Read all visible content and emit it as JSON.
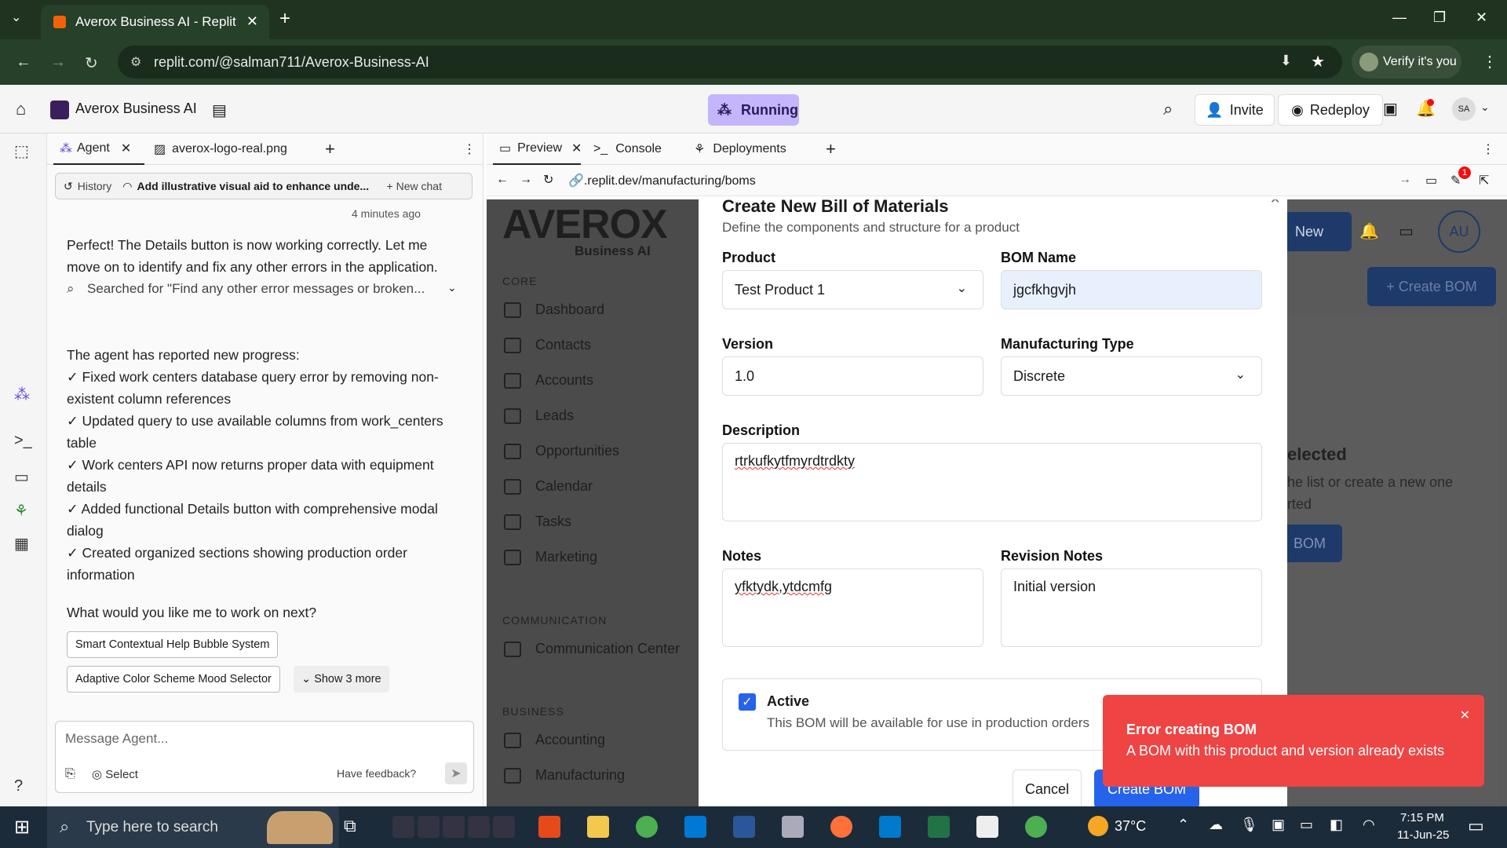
{
  "browser": {
    "tab_title": "Averox Business AI - Replit",
    "url": "replit.com/@salman711/Averox-Business-AI",
    "verify_label": "Verify it's you"
  },
  "replit": {
    "project_name": "Averox Business AI",
    "run_status": "Running",
    "invite_label": "Invite",
    "redeploy_label": "Redeploy",
    "avatar_initials": "SA"
  },
  "agent": {
    "tabs": [
      "Agent",
      "averox-logo-real.png"
    ],
    "history_label": "History",
    "chat_title": "Add illustrative visual aid to enhance unde...",
    "new_chat_label": "New chat",
    "time_ago": "4 minutes ago",
    "message1": "Perfect! The Details button is now working correctly. Let me move on to identify and fix any other errors in the application.",
    "searched": "Searched for \"Find any other error messages or broken...",
    "progress_intro": "The agent has reported new progress:",
    "progress": [
      "✓ Fixed work centers database query error by removing non-existent column references",
      "✓ Updated query to use available columns from work_centers table",
      "✓ Work centers API now returns proper data with equipment details",
      "✓ Added functional Details button with comprehensive modal dialog",
      "✓ Created organized sections showing production order information"
    ],
    "question": "What would you like me to work on next?",
    "suggestions": [
      "Smart Contextual Help Bubble System",
      "Adaptive Color Scheme Mood Selector"
    ],
    "show_more": "Show 3 more",
    "input_placeholder": "Message Agent...",
    "select_label": "Select",
    "feedback_label": "Have feedback?"
  },
  "preview": {
    "tabs": [
      "Preview",
      "Console",
      "Deployments"
    ],
    "url": ".replit.dev/manufacturing/boms",
    "badge_count": "1"
  },
  "app": {
    "logo_text": "AVEROX",
    "logo_sub": "Business AI",
    "sections": {
      "core": "CORE",
      "communication": "COMMUNICATION",
      "business": "BUSINESS"
    },
    "nav": [
      "Dashboard",
      "Contacts",
      "Accounts",
      "Leads",
      "Opportunities",
      "Calendar",
      "Tasks",
      "Marketing"
    ],
    "comm_nav": [
      "Communication Center"
    ],
    "biz_nav": [
      "Accounting",
      "Manufacturing"
    ],
    "new_label": "New",
    "avatar": "AU",
    "create_bom_bg": "+ Create BOM",
    "bg_selected": "elected",
    "bg_hint1": "he list or create a new one",
    "bg_hint2": "rted",
    "bg_btn": "BOM"
  },
  "modal": {
    "title": "Create New Bill of Materials",
    "subtitle": "Define the components and structure for a product",
    "product_label": "Product",
    "product_value": "Test Product 1",
    "bom_name_label": "BOM Name",
    "bom_name_value": "jgcfkhgvjh",
    "version_label": "Version",
    "version_value": "1.0",
    "mtype_label": "Manufacturing Type",
    "mtype_value": "Discrete",
    "desc_label": "Description",
    "desc_value": "rtrkufkytfmyrdtrdkty",
    "notes_label": "Notes",
    "notes_value": "yfktydk,ytdcmfg",
    "rev_label": "Revision Notes",
    "rev_value": "Initial version",
    "active_label": "Active",
    "active_desc": "This BOM will be available for use in production orders",
    "cancel_label": "Cancel",
    "create_label": "Create BOM"
  },
  "toast": {
    "title": "Error creating BOM",
    "message": "A BOM with this product and version already exists"
  },
  "taskbar": {
    "search_placeholder": "Type here to search",
    "temp": "37°C",
    "time": "7:15 PM",
    "date": "11-Jun-25"
  },
  "colors": {
    "accent": "#2563eb",
    "error": "#ef4444",
    "running": "#c4b5fd"
  }
}
